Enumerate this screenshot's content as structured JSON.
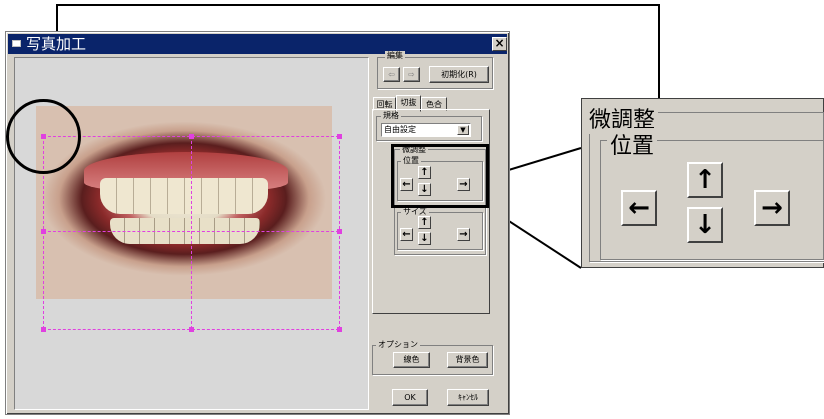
{
  "window": {
    "title": "写真加工",
    "close_symbol": "×"
  },
  "edit_group": {
    "legend": "編集",
    "undo_symbol": "⇦",
    "redo_symbol": "⇨",
    "reset_label": "初期化(R)"
  },
  "tabs": [
    {
      "label": "回転"
    },
    {
      "label": "切抜"
    },
    {
      "label": "色合"
    }
  ],
  "size_group": {
    "legend": "規格",
    "selected": "自由設定",
    "dropdown_symbol": "▼"
  },
  "fine_group": {
    "legend": "微調整",
    "position_legend": "位置",
    "size_legend": "サイズ"
  },
  "arrows": {
    "left": "←",
    "up": "↑",
    "down": "↓",
    "right": "→"
  },
  "option_group": {
    "legend": "オプション",
    "line_color": "線色",
    "bg_color": "背景色"
  },
  "footer": {
    "ok": "OK",
    "cancel": "ｷｬﾝｾﾙ"
  },
  "zoom": {
    "title": "微調整",
    "subtitle": "位置"
  },
  "colors": {
    "titlebar": "#0a246a",
    "guide": "#e040e0",
    "face": "#d4d0c8"
  }
}
